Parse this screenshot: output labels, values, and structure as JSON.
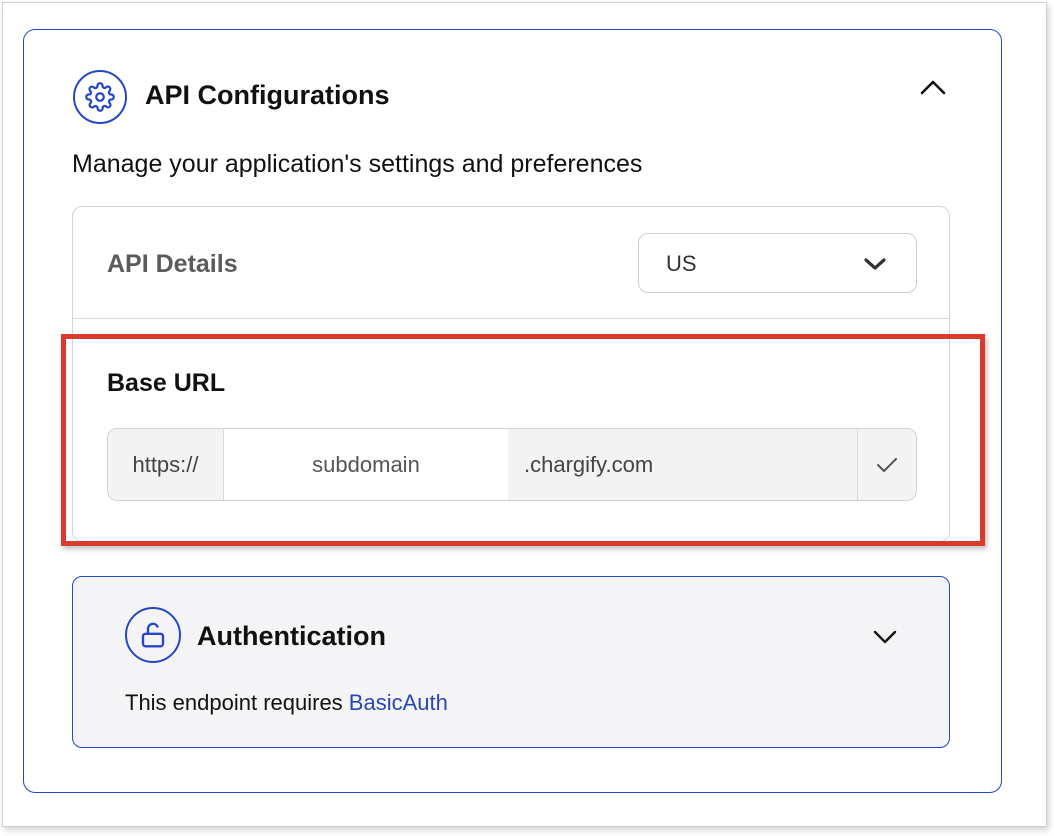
{
  "panel": {
    "title": "API Configurations",
    "subtitle": "Manage your application's settings and preferences",
    "icon": "gear-icon",
    "expanded": true
  },
  "api_details": {
    "title": "API Details",
    "region": {
      "selected": "US"
    },
    "base_url": {
      "label": "Base URL",
      "prefix": "https://",
      "subdomain_placeholder": "subdomain",
      "suffix": ".chargify.com",
      "confirm_icon": "check-icon"
    }
  },
  "authentication": {
    "title": "Authentication",
    "icon": "unlock-icon",
    "description_prefix": "This endpoint requires ",
    "scheme_link": "BasicAuth",
    "expanded": false
  },
  "colors": {
    "accent": "#2648c4",
    "highlight": "#d83a2e",
    "link": "#2648b0"
  }
}
